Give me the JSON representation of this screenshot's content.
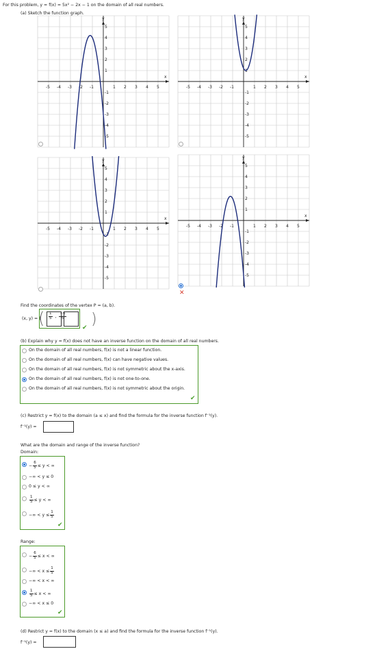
{
  "problem": {
    "intro": "For this problem, y = f(x) = 5x² − 2x − 1 on the domain of all real numbers.",
    "part_a_label": "(a) Sketch the function graph."
  },
  "graphs": {
    "axis_x": "x",
    "axis_y": "y",
    "x_ticks": [
      "-5",
      "-4",
      "-3",
      "-2",
      "-1",
      "1",
      "2",
      "3",
      "4",
      "5"
    ],
    "y_ticks": [
      "5",
      "4",
      "3",
      "2",
      "1",
      "-1",
      "-2",
      "-3",
      "-4",
      "-5"
    ],
    "options": [
      {
        "id": "graph-a",
        "selected": false,
        "vertex": [
          -1.2,
          4.2
        ],
        "opens": "down"
      },
      {
        "id": "graph-b",
        "selected": false,
        "vertex": [
          0.2,
          1.0
        ],
        "opens": "up"
      },
      {
        "id": "graph-c",
        "selected": false,
        "vertex": [
          0.2,
          -1.2
        ],
        "opens": "up"
      },
      {
        "id": "graph-d",
        "selected": true,
        "vertex": [
          -1.2,
          2.2
        ],
        "opens": "down"
      }
    ],
    "graph_result_mark": "✕"
  },
  "vertex": {
    "prompt": "Find the coordinates of the vertex  P = (a, b).",
    "lhs": "(x, y) = (",
    "x_num": "1",
    "x_den": "5",
    "sep": ",",
    "y_num": "−6",
    "y_den": "5",
    "rhs": ")",
    "check": "✔"
  },
  "part_b": {
    "prompt": "(b) Explain why  y = f(x)  does not have an inverse function on the domain of all real numbers.",
    "options": [
      {
        "label": "On the domain of all real numbers, f(x) is not a linear function.",
        "selected": false
      },
      {
        "label": "On the domain of all real numbers, f(x) can have negative values.",
        "selected": false
      },
      {
        "label": "On the domain of all real numbers, f(x) is not symmetric about the x-axis.",
        "selected": false
      },
      {
        "label": "On the domain of all real numbers, f(x) is not one-to-one.",
        "selected": true
      },
      {
        "label": "On the domain of all real numbers, f(x) is not symmetric about the origin.",
        "selected": false
      }
    ],
    "check": "✔"
  },
  "part_c": {
    "prompt": "(c) Restrict  y = f(x)  to the domain  (a ≤ x)  and find the formula for the inverse function  f⁻¹(y).",
    "inverse_label": "f⁻¹(y) =",
    "inverse_value": "",
    "dr_prompt": "What are the domain and range of the inverse function?",
    "domain_label": "Domain:",
    "domain_options": [
      {
        "pre": "− ",
        "num": "6",
        "den": "5",
        "post": " ≤ y < ∞",
        "selected": true
      },
      {
        "pre": "−∞ < y ≤ 0",
        "num": "",
        "den": "",
        "post": "",
        "selected": false
      },
      {
        "pre": "0 ≤ y < ∞",
        "num": "",
        "den": "",
        "post": "",
        "selected": false
      },
      {
        "pre": "",
        "num": "1",
        "den": "5",
        "post": " ≤ y < ∞",
        "selected": false
      },
      {
        "pre": "−∞ < y ≤ ",
        "num": "1",
        "den": "5",
        "post": "",
        "selected": false
      }
    ],
    "range_label": "Range:",
    "range_options": [
      {
        "pre": "− ",
        "num": "6",
        "den": "5",
        "post": " ≤ x < ∞",
        "selected": false
      },
      {
        "pre": "−∞ < x ≤ ",
        "num": "1",
        "den": "5",
        "post": "",
        "selected": false
      },
      {
        "pre": "−∞ < x < ∞",
        "num": "",
        "den": "",
        "post": "",
        "selected": false
      },
      {
        "pre": "",
        "num": "1",
        "den": "5",
        "post": " ≤ x < ∞",
        "selected": true
      },
      {
        "pre": "−∞ < x ≤ 0",
        "num": "",
        "den": "",
        "post": "",
        "selected": false
      }
    ],
    "check": "✔"
  },
  "part_d": {
    "prompt": "(d) Restrict  y = f(x)  to the domain  (x ≤ a)  and find the formula for the inverse function  f⁻¹(y).",
    "inverse_label": "f⁻¹(y) =",
    "inverse_value": ""
  },
  "colors": {
    "correct": "#4c9a2a",
    "wrong": "#d63a2b",
    "selected": "#2a72d4"
  }
}
